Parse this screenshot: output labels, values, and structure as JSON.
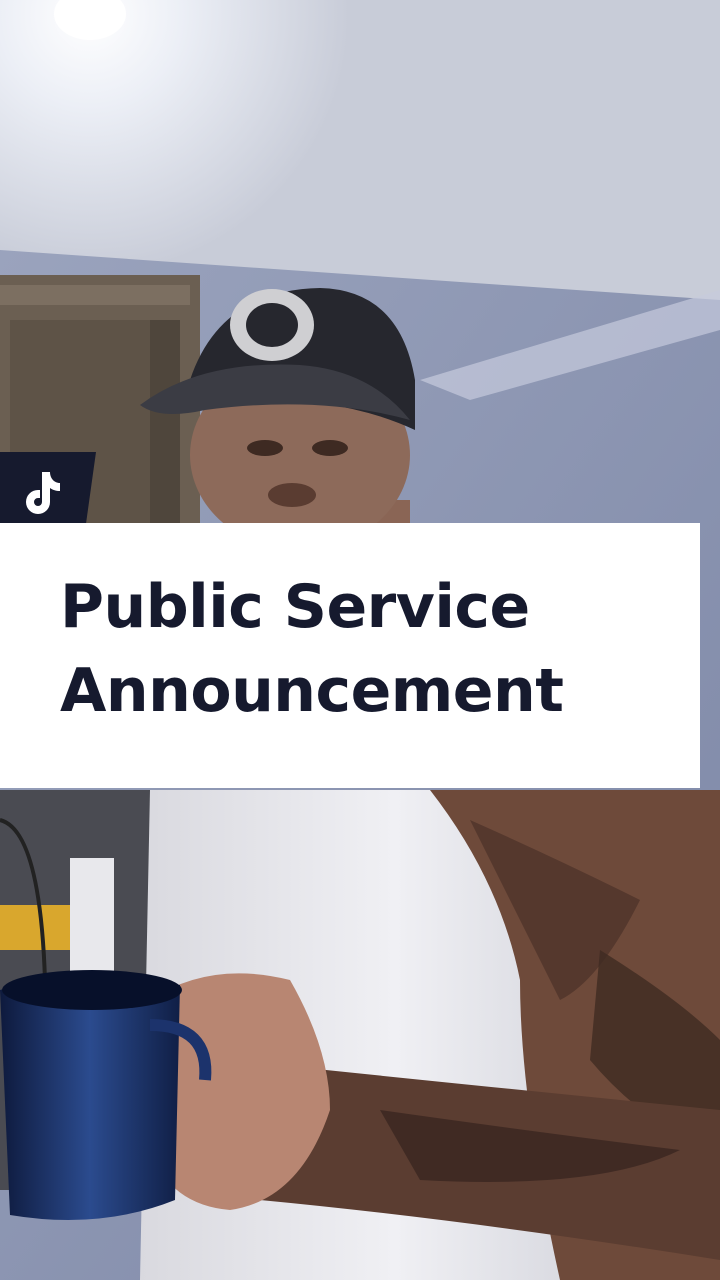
{
  "video": {
    "caption_line_1": "Public Service",
    "caption_line_2": "Announcement"
  },
  "icons": {
    "platform": "tiktok-icon"
  },
  "colors": {
    "caption_background": "#ffffff",
    "caption_text": "#161a2e",
    "badge_background": "#161a2e",
    "badge_icon": "#ffffff"
  }
}
